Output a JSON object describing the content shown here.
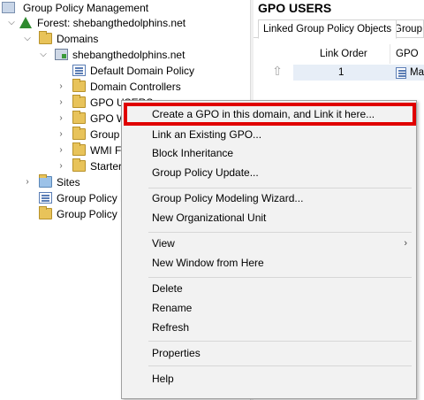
{
  "tree": {
    "root": "Group Policy Management",
    "forest": "Forest: shebangthedolphins.net",
    "domains": "Domains",
    "domain": "shebangthedolphins.net",
    "children": [
      "Default Domain Policy",
      "Domain Controllers",
      "GPO USERS",
      "GPO W",
      "Group",
      "WMI F",
      "Starter"
    ],
    "sites": "Sites",
    "gpm": "Group Policy M",
    "gpr": "Group Policy R"
  },
  "right_pane": {
    "title": "GPO USERS",
    "tabs": [
      "Linked Group Policy Objects",
      "Group P"
    ],
    "columns": [
      "Link Order",
      "GPO"
    ],
    "row": {
      "link_order": "1",
      "gpo": "Ma"
    }
  },
  "context_menu": {
    "items": [
      "Create a GPO in this domain, and Link it here...",
      "Link an Existing GPO...",
      "Block Inheritance",
      "Group Policy Update...",
      "Group Policy Modeling Wizard...",
      "New Organizational Unit",
      "View",
      "New Window from Here",
      "Delete",
      "Rename",
      "Refresh",
      "Properties",
      "Help"
    ],
    "submenu_arrow": "›"
  },
  "colors": {
    "highlight_border": "#e00000",
    "menu_bg": "#f2f2f2",
    "selection_bg": "#e7eef7"
  },
  "icons": {
    "expanded": "chevron-down-icon",
    "collapsed": "chevron-right-icon",
    "folder": "folder-icon",
    "gpo": "gpo-icon",
    "domain": "domain-icon"
  }
}
